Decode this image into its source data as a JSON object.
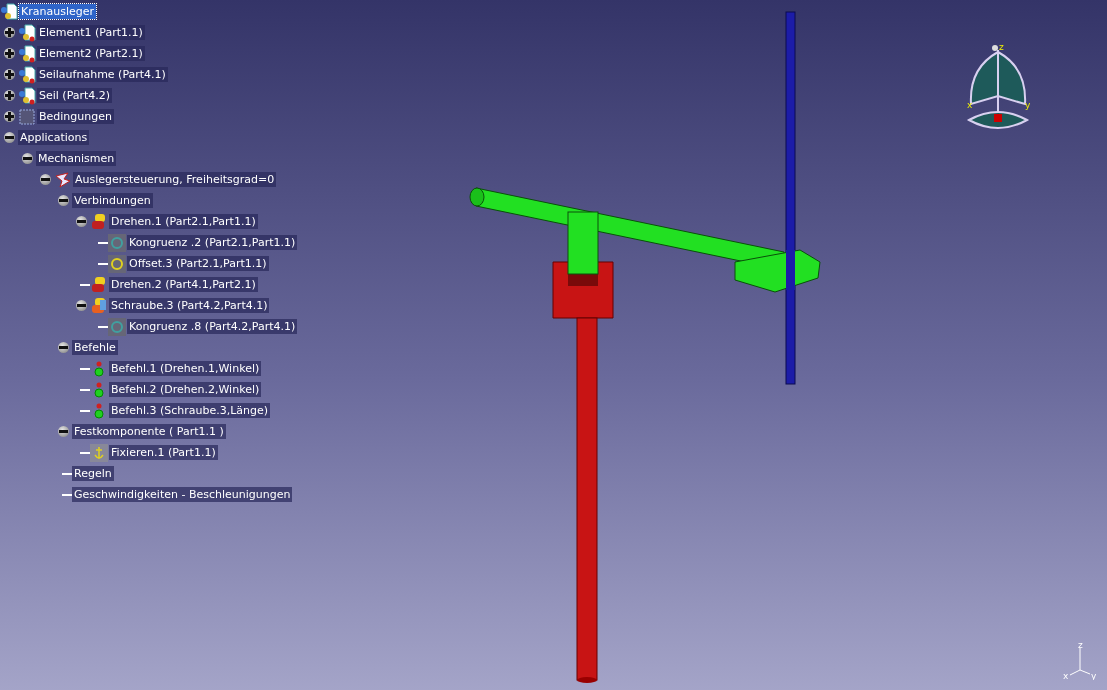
{
  "tree": {
    "label": "Kranausleger",
    "kind": "product",
    "selected": true,
    "children": [
      {
        "label": "Element1 (Part1.1)",
        "kind": "part",
        "expanded": false,
        "selected": false
      },
      {
        "label": "Element2 (Part2.1)",
        "kind": "part",
        "expanded": false,
        "selected": false
      },
      {
        "label": "Seilaufnahme (Part4.1)",
        "kind": "part",
        "expanded": false,
        "selected": false
      },
      {
        "label": "Seil (Part4.2)",
        "kind": "part",
        "expanded": false,
        "selected": false
      },
      {
        "label": "Bedingungen",
        "kind": "constraints",
        "expanded": false,
        "selected": false
      },
      {
        "label": "Applications",
        "expanded": true,
        "selected": false,
        "children": [
          {
            "label": "Mechanismen",
            "expanded": true,
            "selected": false,
            "children": [
              {
                "label": "Auslegersteuerung, Freiheitsgrad=0",
                "kind": "mechanism",
                "expanded": true,
                "selected": false,
                "children": [
                  {
                    "label": "Verbindungen",
                    "expanded": true,
                    "selected": false,
                    "children": [
                      {
                        "label": "Drehen.1 (Part2.1,Part1.1)",
                        "kind": "revolute",
                        "expanded": true,
                        "selected": false,
                        "children": [
                          {
                            "label": "Kongruenz .2 (Part2.1,Part1.1)",
                            "kind": "coincidence",
                            "selected": false
                          },
                          {
                            "label": "Offset.3 (Part2.1,Part1.1)",
                            "kind": "offset",
                            "selected": false
                          }
                        ]
                      },
                      {
                        "label": "Drehen.2 (Part4.1,Part2.1)",
                        "kind": "revolute",
                        "selected": false
                      },
                      {
                        "label": "Schraube.3 (Part4.2,Part4.1)",
                        "kind": "screw",
                        "expanded": true,
                        "selected": false,
                        "children": [
                          {
                            "label": "Kongruenz .8 (Part4.2,Part4.1)",
                            "kind": "coincidence",
                            "selected": false
                          }
                        ]
                      }
                    ]
                  },
                  {
                    "label": "Befehle",
                    "expanded": true,
                    "selected": false,
                    "children": [
                      {
                        "label": "Befehl.1 (Drehen.1,Winkel)",
                        "kind": "command",
                        "selected": false
                      },
                      {
                        "label": "Befehl.2 (Drehen.2,Winkel)",
                        "kind": "command",
                        "selected": false
                      },
                      {
                        "label": "Befehl.3 (Schraube.3,Länge)",
                        "kind": "command",
                        "selected": false
                      }
                    ]
                  },
                  {
                    "label": "Festkomponente ( Part1.1 )",
                    "expanded": true,
                    "selected": false,
                    "children": [
                      {
                        "label": "Fixieren.1 (Part1.1)",
                        "kind": "fix",
                        "selected": false
                      }
                    ]
                  },
                  {
                    "label": "Regeln",
                    "selected": false
                  },
                  {
                    "label": "Geschwindigkeiten - Beschleunigungen",
                    "selected": false
                  }
                ]
              }
            ]
          }
        ]
      }
    ]
  },
  "compass": {
    "axes": [
      "z",
      "x",
      "y"
    ]
  },
  "axis_triad": {
    "axes": [
      "z",
      "x",
      "y"
    ]
  }
}
